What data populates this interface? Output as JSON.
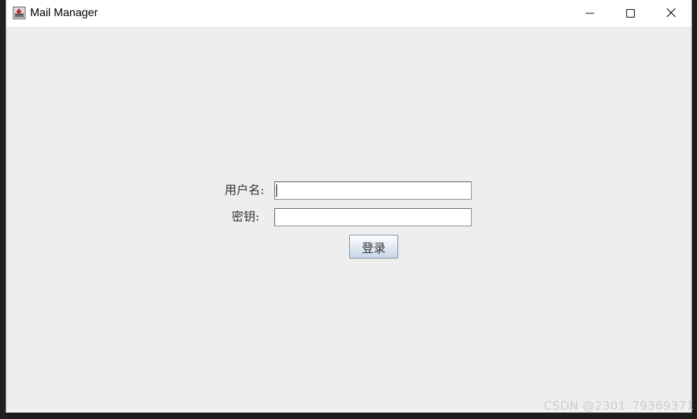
{
  "window": {
    "title": "Mail Manager",
    "icon": "java-app-icon",
    "controls": {
      "minimize": "minimize-icon",
      "maximize": "maximize-icon",
      "close": "close-icon"
    }
  },
  "login_form": {
    "username_label": "用户名:",
    "username_value": "",
    "password_label": "密钥:",
    "password_value": "",
    "submit_label": "登录"
  },
  "watermark": "CSDN @2301_79369371",
  "colors": {
    "window_background": "#eeeeee",
    "titlebar_background": "#ffffff",
    "button_gradient_bottom": "#c6d6e8",
    "field_border": "#7a8a99"
  }
}
